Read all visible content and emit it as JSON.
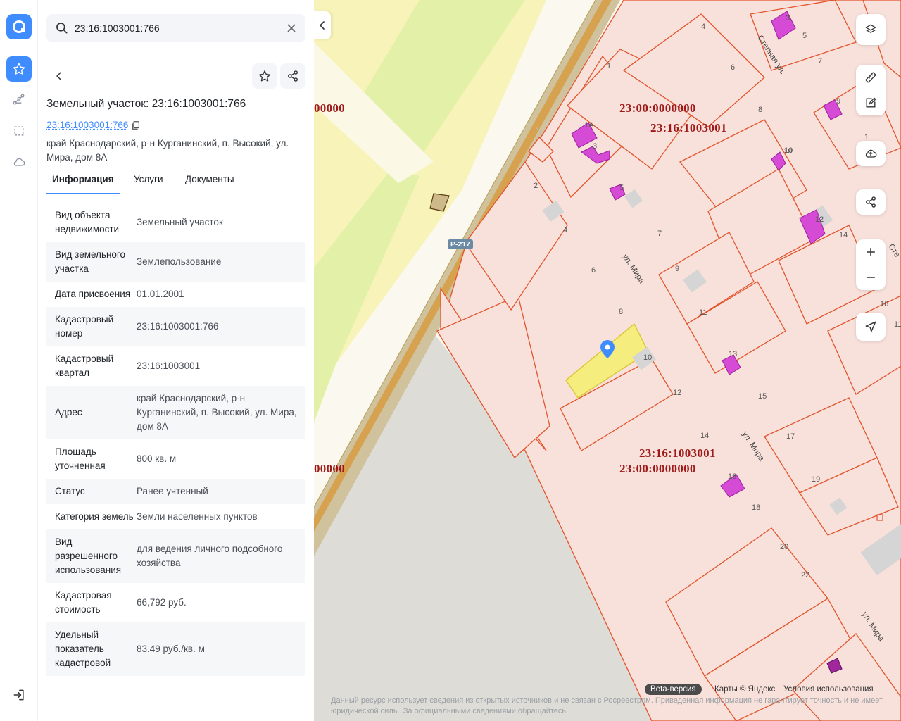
{
  "search": {
    "value": "23:16:1003001:766"
  },
  "panel": {
    "title": "Земельный участок: 23:16:1003001:766",
    "cad_link": "23:16:1003001:766",
    "address": "край Краснодарский, р-н Курганинский, п. Высокий, ул. Мира, дом 8А",
    "tabs": [
      {
        "label": "Информация"
      },
      {
        "label": "Услуги"
      },
      {
        "label": "Документы"
      }
    ],
    "active_tab": "Информация",
    "rows": [
      {
        "k": "Вид объекта недвижимости",
        "v": "Земельный участок"
      },
      {
        "k": "Вид земельного участка",
        "v": "Землепользование"
      },
      {
        "k": "Дата присвоения",
        "v": "01.01.2001"
      },
      {
        "k": "Кадастровый номер",
        "v": "23:16:1003001:766"
      },
      {
        "k": "Кадастровый квартал",
        "v": "23:16:1003001"
      },
      {
        "k": "Адрес",
        "v": "край Краснодарский, р-н Курганинский, п. Высокий, ул. Мира, дом 8А"
      },
      {
        "k": "Площадь уточненная",
        "v": "800 кв. м"
      },
      {
        "k": "Статус",
        "v": "Ранее учтенный"
      },
      {
        "k": "Категория земель",
        "v": "Земли населенных пунктов"
      },
      {
        "k": "Вид разрешенного использования",
        "v": "для ведения личного подсобного хозяйства"
      },
      {
        "k": "Кадастровая стоимость",
        "v": "66,792 руб."
      },
      {
        "k": "Удельный показатель кадастровой",
        "v": "83.49 руб./кв. м"
      }
    ]
  },
  "map": {
    "labels": {
      "quarter_top": "23:00:0000000",
      "quarter_top2": "23:16:1003001",
      "quarter_bottom": "23:16:1003001",
      "quarter_bottom2": "23:00:0000000",
      "left_top": "00000",
      "left_bottom": "00000"
    },
    "streets": {
      "mira1": "ул. Мира",
      "mira2": "ул. Мира",
      "mira3": "ул. Мира",
      "stepnaya": "Степная ул.",
      "ste_cut": "Сте",
      "ste_cut2": "Сте"
    },
    "road": "Р-217",
    "house_numbers": [
      "4",
      "6",
      "8",
      "10",
      "3",
      "5",
      "7",
      "9",
      "1",
      "1А",
      "3",
      "5",
      "2",
      "4",
      "6",
      "7",
      "8",
      "9",
      "10",
      "11",
      "12",
      "13",
      "14",
      "15",
      "16",
      "17",
      "18",
      "19",
      "20",
      "22",
      "10",
      "12",
      "14",
      "16",
      "11",
      "1"
    ],
    "footer": {
      "beta": "Beta-версия",
      "maps": "Карты © Яндекс",
      "terms": "Условия использования",
      "disclaimer": "Данный ресурс использует сведения из открытых источников и не связан с Росреестром. Приведенная информация не гарантирует точность и не имеет юридической силы. За официальными сведениями обращайтесь"
    }
  },
  "colors": {
    "accent": "#3f8cff",
    "parcel_fill": "#f9e1db",
    "parcel_stroke": "#e2542c",
    "selected_fill": "#f5ee7a",
    "building": "#d64bd6",
    "label": "#9e1a1a"
  }
}
